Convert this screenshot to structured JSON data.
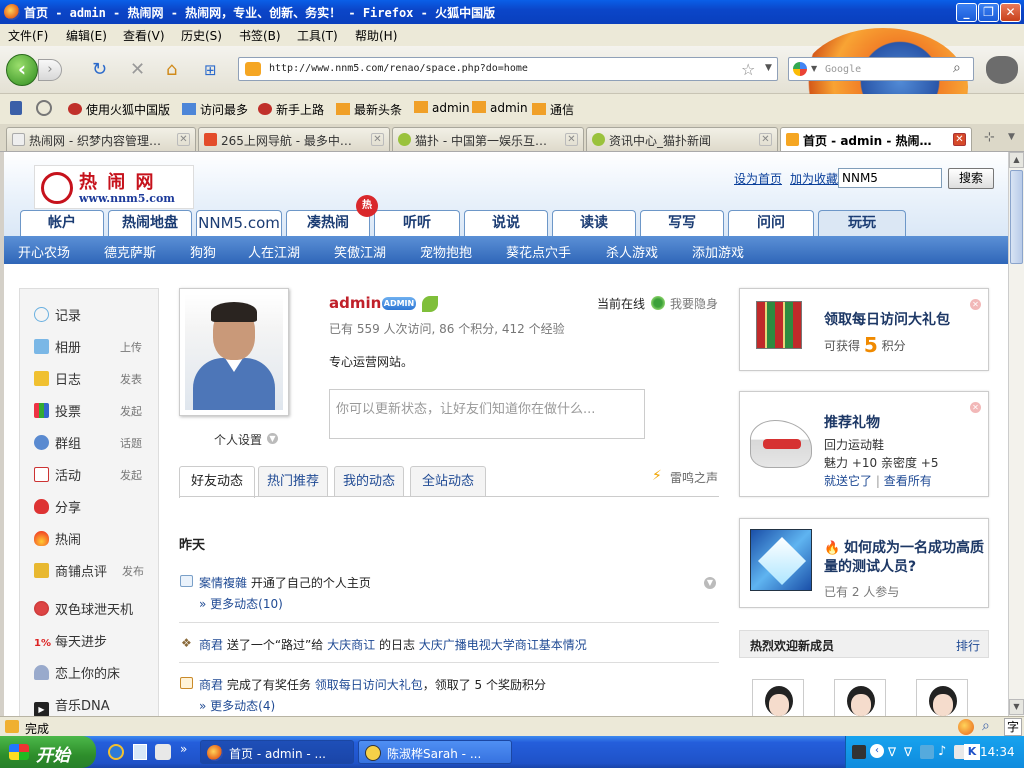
{
  "window": {
    "title": "首页 - admin - 热闹网 - 热闹网，专业、创新、务实！ - Firefox - 火狐中国版",
    "min": "_",
    "max": "❐",
    "close": "✕"
  },
  "menu": [
    "文件(F)",
    "编辑(E)",
    "查看(V)",
    "历史(S)",
    "书签(B)",
    "工具(T)",
    "帮助(H)"
  ],
  "nav": {
    "url": "http://www.nnm5.com/renao/space.php?do=home",
    "search_placeholder": "Google"
  },
  "bookmarks": [
    "使用火狐中国版",
    "访问最多",
    "新手上路",
    "最新头条",
    "admin",
    "admin",
    "通信"
  ],
  "tabs": [
    {
      "label": "热闹网 - 织梦内容管理…"
    },
    {
      "label": "265上网导航 - 最多中…"
    },
    {
      "label": "猫扑 - 中国第一娱乐互…"
    },
    {
      "label": "资讯中心_猫扑新闻"
    },
    {
      "label": "首页 - admin - 热闹…"
    }
  ],
  "site": {
    "logo_text": "热 闹 网",
    "logo_url": "www.nnm5.com",
    "set_home": "设为首页",
    "add_fav": "加为收藏",
    "search_value": "NNM5",
    "search_btn": "搜索",
    "hot_badge": "热",
    "main_nav": [
      "帐户",
      "热闹地盘",
      "NNM5.com",
      "凑热闹",
      "听听",
      "说说",
      "读读",
      "写写",
      "问问",
      "玩玩"
    ],
    "sub_nav": [
      "开心农场",
      "德克萨斯",
      "狗狗",
      "人在江湖",
      "笑傲江湖",
      "宠物抱抱",
      "葵花点穴手",
      "杀人游戏",
      "添加游戏"
    ]
  },
  "sidebar": {
    "items": [
      {
        "label": "记录",
        "sub": ""
      },
      {
        "label": "相册",
        "sub": "上传"
      },
      {
        "label": "日志",
        "sub": "发表"
      },
      {
        "label": "投票",
        "sub": "发起"
      },
      {
        "label": "群组",
        "sub": "话题"
      },
      {
        "label": "活动",
        "sub": "发起"
      },
      {
        "label": "分享",
        "sub": ""
      },
      {
        "label": "热闹",
        "sub": ""
      },
      {
        "label": "商铺点评",
        "sub": "发布"
      },
      {
        "label": "双色球泄天机",
        "sub": ""
      },
      {
        "label": "每天进步",
        "sub": "",
        "prefix": "1%"
      },
      {
        "label": "恋上你的床",
        "sub": ""
      },
      {
        "label": "音乐DNA",
        "sub": ""
      }
    ]
  },
  "profile": {
    "name": "admin",
    "admin_tag": "ADMIN",
    "stats": "已有 559 人次访问, 86 个积分, 412 个经验",
    "motto": "专心运营网站。",
    "status_placeholder": "你可以更新状态，让好友们知道你在做什么...",
    "online": "当前在线",
    "hide": "我要隐身",
    "settings": "个人设置"
  },
  "feed": {
    "tabs": [
      "好友动态",
      "热门推荐",
      "我的动态",
      "全站动态"
    ],
    "leiming": "雷鸣之声",
    "day": "昨天",
    "rows": [
      {
        "user": "案情複雜",
        "text": "开通了自己的个人主页",
        "more": "» 更多动态(10)"
      },
      {
        "user": "商君",
        "pre": "送了一个“路过”给",
        "target": "大庆商讧",
        "mid": "的日志",
        "link": "大庆广播电视大学商讧基本情况"
      },
      {
        "user": "商君",
        "pre": "完成了有奖任务",
        "link": "领取每日访问大礼包",
        "post": "，领取了 5 个奖励积分",
        "more": "» 更多动态(4)"
      }
    ]
  },
  "right": {
    "gift_title": "领取每日访问大礼包",
    "gift_pre": "可获得",
    "gift_points": "5",
    "gift_post": "积分",
    "rec_title": "推荐礼物",
    "rec_item": "回力运动鞋",
    "rec_stats": "魅力 +10  亲密度 +5",
    "rec_send": "就送它了",
    "rec_sep": "|",
    "rec_all": "查看所有",
    "q_title": "如何成为一名成功高质量的测试人员?",
    "q_joined": "已有 2 人参与",
    "new_head": "热烈欢迎新成员",
    "new_rank": "排行"
  },
  "statusbar": {
    "text": "完成"
  },
  "taskbar": {
    "start": "开始",
    "items": [
      "首页 - admin - ...",
      "陈淑桦Sarah - ..."
    ],
    "clock": "14:34"
  }
}
